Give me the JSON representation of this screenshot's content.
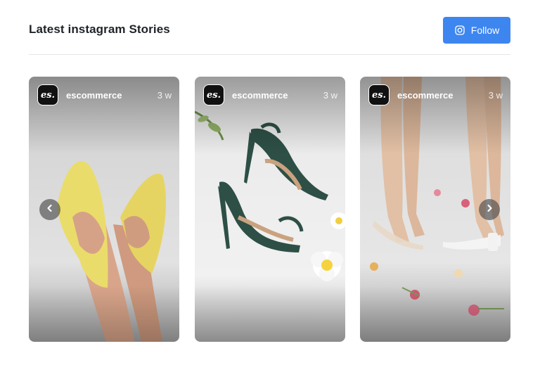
{
  "header": {
    "title": "Latest instagram Stories",
    "follow_label": "Follow"
  },
  "colors": {
    "accent": "#3d86f0",
    "text": "#1f2328",
    "divider": "#e6e6e6"
  },
  "stories": [
    {
      "avatar_text": "es.",
      "username": "escommerce",
      "age": "3 w",
      "image": "yellow pointed flats on crossed legs"
    },
    {
      "avatar_text": "es.",
      "username": "escommerce",
      "age": "3 w",
      "image": "dark green strappy heels with flowers"
    },
    {
      "avatar_text": "es.",
      "username": "escommerce",
      "age": "3 w",
      "image": "legs in clear sandals among petals"
    }
  ],
  "icons": {
    "follow": "instagram-icon",
    "prev": "chevron-left-icon",
    "next": "chevron-right-icon"
  }
}
